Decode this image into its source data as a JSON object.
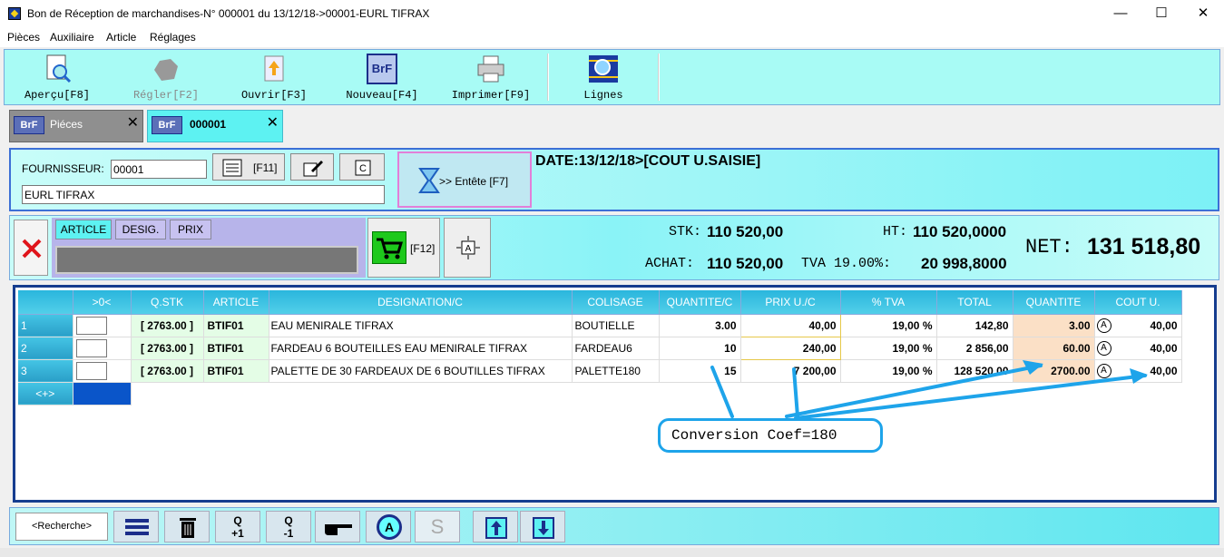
{
  "window": {
    "title": "Bon de Réception de marchandises-N° 000001 du 13/12/18->00001-EURL TIFRAX",
    "minimize": "—",
    "maximize": "☐",
    "close": "✕"
  },
  "menu": [
    "Pièces",
    "Auxiliaire",
    "Article",
    "Réglages"
  ],
  "toolbar": {
    "apercu": "Aperçu[F8]",
    "regler": "Régler[F2]",
    "ouvrir": "Ouvrir[F3]",
    "nouveau": "Nouveau[F4]",
    "nouveau_icon": "BrF",
    "imprimer": "Imprimer[F9]",
    "lignes": "Lignes"
  },
  "tabs": [
    {
      "icon": "BrF",
      "label": "Piéces",
      "close": "✕"
    },
    {
      "icon": "BrF",
      "label": "000001",
      "close": "✕"
    }
  ],
  "header": {
    "fournisseur_label": "FOURNISSEUR:",
    "fournisseur_code": "00001",
    "fournisseur_name": "EURL TIFRAX",
    "f11": "[F11]",
    "entete": ">> Entête [F7]",
    "date_info": "DATE:13/12/18>[COUT U.SAISIE]"
  },
  "filters": {
    "article": "ARTICLE",
    "desig": "DESIG.",
    "prix": "PRIX",
    "f12": "[F12]"
  },
  "totals": {
    "stk_label": "STK:",
    "stk_value": "110 520,00",
    "ht_label": "HT:",
    "ht_value": "110 520,0000",
    "achat_label": "ACHAT:",
    "achat_value": "110 520,00",
    "tva_label": "TVA 19.00%:",
    "tva_value": "20 998,8000",
    "net_label": "NET:",
    "net_value": "131 518,80"
  },
  "grid": {
    "columns": [
      "",
      ">0<",
      "Q.STK",
      "ARTICLE",
      "DESIGNATION/C",
      "COLISAGE",
      "QUANTITE/C",
      "PRIX U./C",
      "% TVA",
      "TOTAL",
      "QUANTITE",
      "COUT U."
    ],
    "rows": [
      {
        "n": "1",
        "qstk": "[ 2763.00 ]",
        "article": "BTIF01",
        "designation": "EAU MENIRALE TIFRAX",
        "colisage": "BOUTIELLE",
        "quantite_c": "3.00",
        "prix_c": "40,00",
        "tva": "19,00 %",
        "total": "142,80",
        "quantite": "3.00",
        "cout": "40,00"
      },
      {
        "n": "2",
        "qstk": "[ 2763.00 ]",
        "article": "BTIF01",
        "designation": "FARDEAU 6 BOUTEILLES  EAU MENIRALE TIFRAX",
        "colisage": "FARDEAU6",
        "quantite_c": "10",
        "prix_c": "240,00",
        "tva": "19,00 %",
        "total": "2 856,00",
        "quantite": "60.00",
        "cout": "40,00"
      },
      {
        "n": "3",
        "qstk": "[ 2763.00 ]",
        "article": "BTIF01",
        "designation": "PALETTE DE 30 FARDEAUX DE 6 BOUTILLES TIFRAX",
        "colisage": "PALETTE180",
        "quantite_c": "15",
        "prix_c": "7 200,00",
        "tva": "19,00 %",
        "total": "128 520,00",
        "quantite": "2700.00",
        "cout": "40,00"
      }
    ],
    "new_row": "<+>",
    "a_glyph": "A"
  },
  "annotation": "Conversion Coef=180",
  "bottom": {
    "recherche": "<Recherche>",
    "q_plus": "Q\n+1",
    "q_plus_top": "Q",
    "q_plus_bottom": "+1",
    "q_minus_top": "Q",
    "q_minus_bottom": "-1",
    "a_glyph": "A",
    "s_glyph": "S"
  }
}
